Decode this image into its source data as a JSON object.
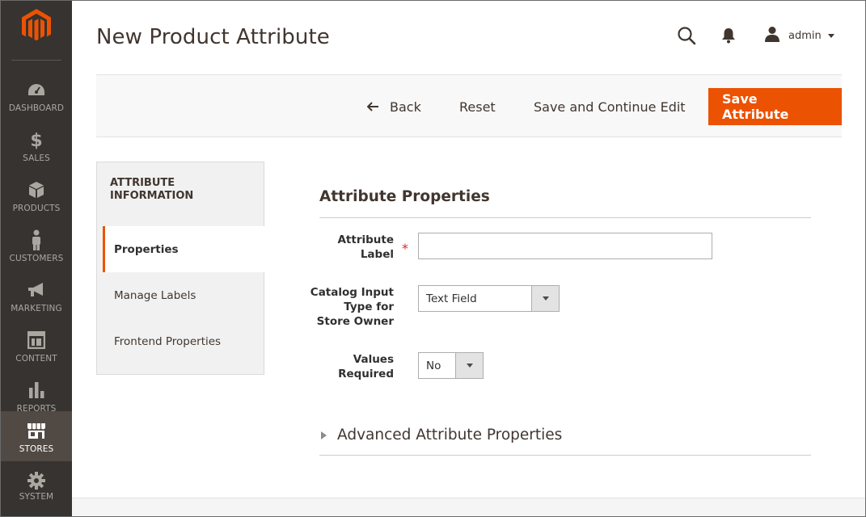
{
  "sidebar": {
    "logo": "magento-logo",
    "items": [
      {
        "label": "DASHBOARD",
        "icon": "dashboard-gauge-icon",
        "active": false
      },
      {
        "label": "SALES",
        "icon": "dollar-icon",
        "active": false
      },
      {
        "label": "PRODUCTS",
        "icon": "cube-icon",
        "active": false
      },
      {
        "label": "CUSTOMERS",
        "icon": "person-icon",
        "active": false
      },
      {
        "label": "MARKETING",
        "icon": "megaphone-icon",
        "active": false
      },
      {
        "label": "CONTENT",
        "icon": "layout-icon",
        "active": false
      },
      {
        "label": "REPORTS",
        "icon": "bar-chart-icon",
        "active": false
      },
      {
        "label": "STORES",
        "icon": "storefront-icon",
        "active": true
      },
      {
        "label": "SYSTEM",
        "icon": "gear-icon",
        "active": false
      }
    ]
  },
  "header": {
    "title": "New Product Attribute",
    "user": "admin"
  },
  "actions": {
    "back": "Back",
    "reset": "Reset",
    "save_continue": "Save and Continue Edit",
    "save": "Save Attribute"
  },
  "tabs": {
    "title": "ATTRIBUTE INFORMATION",
    "items": [
      {
        "label": "Properties",
        "active": true
      },
      {
        "label": "Manage Labels",
        "active": false
      },
      {
        "label": "Frontend Properties",
        "active": false
      }
    ]
  },
  "form": {
    "section_title": "Attribute Properties",
    "attribute_label": {
      "label_line1": "Attribute",
      "label_line2": "Label",
      "required_mark": "*",
      "value": ""
    },
    "input_type": {
      "label_line1": "Catalog Input",
      "label_line2": "Type for",
      "label_line3": "Store Owner",
      "value": "Text Field"
    },
    "values_required": {
      "label_line1": "Values",
      "label_line2": "Required",
      "value": "No"
    },
    "advanced_section": "Advanced Attribute Properties"
  },
  "colors": {
    "sidebar_bg": "#373330",
    "sidebar_active": "#514943",
    "accent": "#eb5202",
    "required": "#e22626"
  }
}
